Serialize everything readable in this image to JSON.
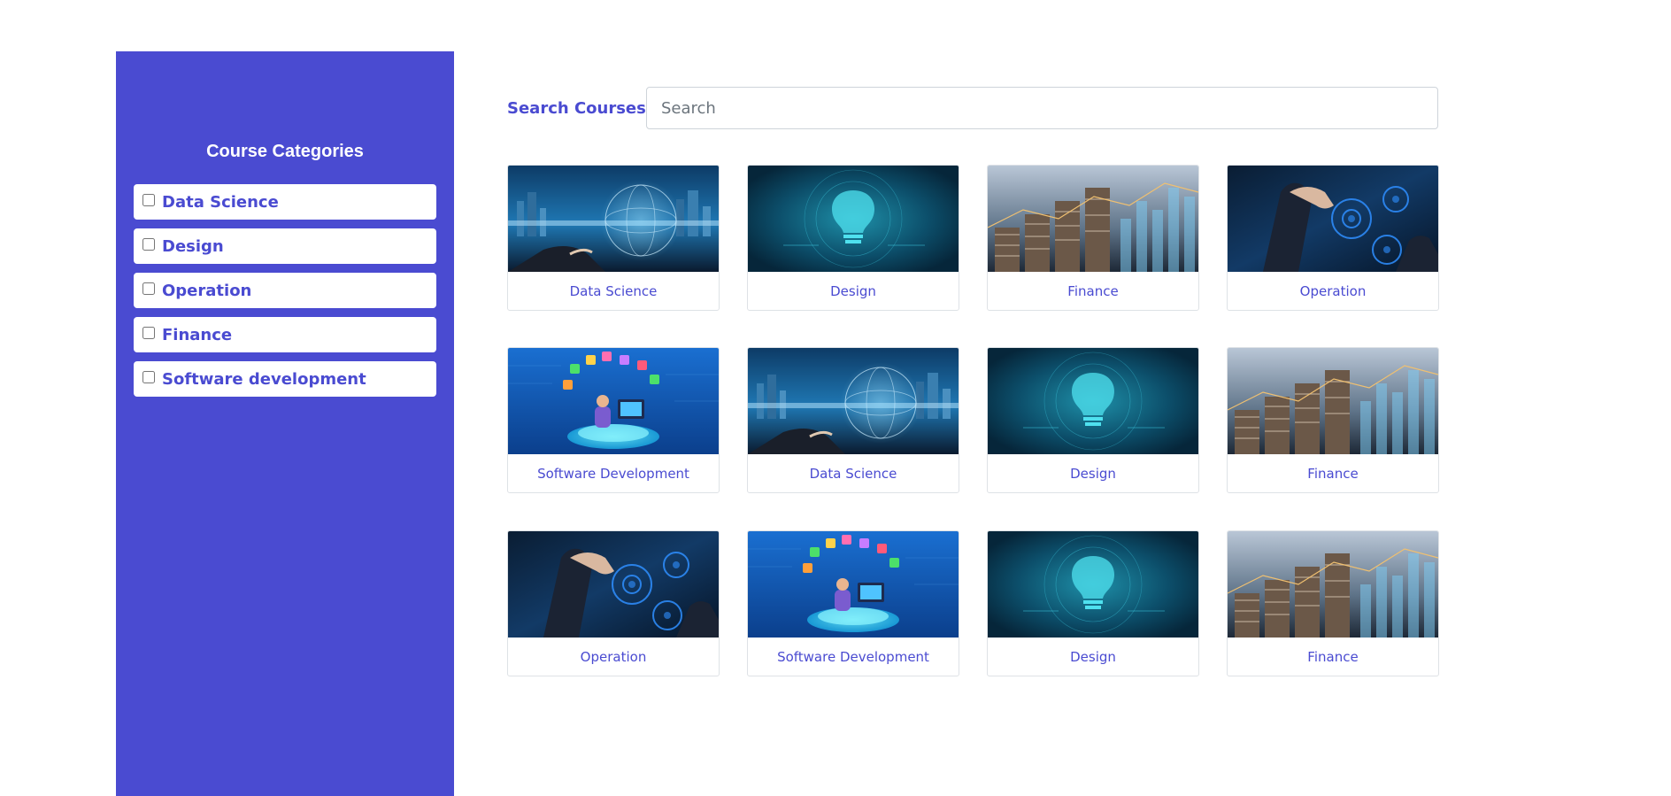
{
  "sidebar": {
    "title": "Course Categories",
    "categories": [
      {
        "label": "Data Science",
        "checked": false
      },
      {
        "label": "Design",
        "checked": false
      },
      {
        "label": "Operation",
        "checked": false
      },
      {
        "label": "Finance",
        "checked": false
      },
      {
        "label": "Software development",
        "checked": false
      }
    ]
  },
  "search": {
    "label": "Search Courses",
    "placeholder": "Search",
    "value": ""
  },
  "courses": [
    {
      "title": "Data Science",
      "image": "data-science"
    },
    {
      "title": "Design",
      "image": "design"
    },
    {
      "title": "Finance",
      "image": "finance"
    },
    {
      "title": "Operation",
      "image": "operation"
    },
    {
      "title": "Software Development",
      "image": "software-development"
    },
    {
      "title": "Data Science",
      "image": "data-science"
    },
    {
      "title": "Design",
      "image": "design"
    },
    {
      "title": "Finance",
      "image": "finance"
    },
    {
      "title": "Operation",
      "image": "operation"
    },
    {
      "title": "Software Development",
      "image": "software-development"
    },
    {
      "title": "Design",
      "image": "design"
    },
    {
      "title": "Finance",
      "image": "finance"
    }
  ],
  "colors": {
    "brand": "#4a4bd1",
    "card_border": "#dee2e6"
  }
}
